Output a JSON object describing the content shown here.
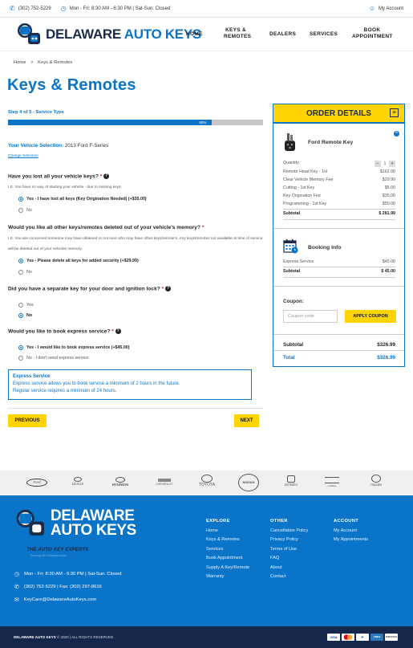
{
  "topbar": {
    "phone": "(302) 752-5229",
    "hours": "Mon - Fri: 8:30 AM - 6:30 PM | Sat-Sun: Closed",
    "account": "My Account"
  },
  "brand": {
    "word_a": "DELAWARE",
    "word_b": " AUTO KEYS"
  },
  "nav": [
    "HOME",
    "KEYS &\nREMOTES",
    "DEALERS",
    "SERVICES",
    "BOOK\nAPPOINTMENT"
  ],
  "breadcrumb": {
    "home": "Home",
    "sep": ">",
    "current": "Keys & Remotes"
  },
  "page_title": "Keys & Remotes",
  "progress": {
    "label": "Step 4 of 5 - Service Type",
    "percent": 80,
    "percent_text": "80%"
  },
  "vehicle": {
    "label": "Your Vehicle Selection:",
    "value": " 2013 Ford F-Series",
    "change": "Change Selection"
  },
  "questions": [
    {
      "text": "Have you lost all your vehicle keys?",
      "note": "I.E. You have no way of starting your vehicle - due to missing keys.",
      "options": [
        "Yes - I have lost all keys (Key Origination Needed) (+$35.00)",
        "No"
      ]
    },
    {
      "text": "Would you like all other keys/remotes deleted out of your vehicle's memory?",
      "note": "I.E. You are concerned someone may have obtained or not sure who may have other keys/remote's. Any keys/remotes not available at time of service will be deleted out of your vehicles memory.",
      "options": [
        "Yes - Please delete all keys for added security (+$29.99)",
        "No"
      ]
    },
    {
      "text": "Did you have a separate key for your door and ignition lock?",
      "options": [
        "Yes",
        "No"
      ]
    },
    {
      "text": "Would you like to book express service?",
      "options": [
        "Yes - I would like to book express service (+$45.00)",
        "No - I don't need express service"
      ]
    }
  ],
  "express_box": {
    "title": "Express Service",
    "line1": "Express service allows you to book service a minimum of 2 hours in the future.",
    "line2": "Regular service requires a minimum of 24 hours."
  },
  "buttons": {
    "previous": "PREVIOUS",
    "next": "NEXT"
  },
  "order": {
    "title": "ORDER DETAILS",
    "menu_icon": "≡",
    "product": "Ford Remote Key",
    "quantity_label": "Quantity",
    "quantity": "1",
    "lines": [
      {
        "label": "Remote Head Key - 1st",
        "value": "$162.00"
      },
      {
        "label": "Clear Vehicle Memory Fee",
        "value": "$29.99"
      },
      {
        "label": "Cutting - 1st Key",
        "value": "$5.00"
      },
      {
        "label": "Key Origination Fee",
        "value": "$35.00"
      },
      {
        "label": "Programming - 1st Key",
        "value": "$50.00"
      }
    ],
    "subtotal_label": "Subtotal",
    "subtotal": "$ 281.99",
    "booking_title": "Booking Info",
    "booking_line_label": "Express Service",
    "booking_line_value": "$45.00",
    "booking_subtotal": "$ 45.00",
    "coupon_label": "Coupon:",
    "coupon_placeholder": "Coupon code",
    "coupon_button": "APPLY COUPON",
    "summary_subtotal_label": "Subtotal",
    "summary_subtotal": "$326.99",
    "total_label": "Total",
    "total": "$326.99"
  },
  "brands": [
    "Ford",
    "LEXUS",
    "HYUNDAI",
    "CHEVROLET",
    "TOYOTA",
    "NISSAN",
    "HONDA",
    "Cadillac",
    "mazda"
  ],
  "footer": {
    "tagline": "THE AUTO KEY EXPERTS",
    "tagline_sub": "Serving the Delaware Area",
    "hours": "Mon - Fri: 8:30 AM - 6:30 PM | Sat-Sun: Closed",
    "phone": "(302) 752-5229 | Fax: (302) 297-8616",
    "email": "KeyCare@DelawareAutoKeys.com",
    "explore_title": "EXPLORE",
    "explore": [
      "Home",
      "Keys & Remotes",
      "Services",
      "Book Appointment",
      "Supply A Key/Remote",
      "Warranty"
    ],
    "other_title": "OTHER",
    "other": [
      "Cancellation Policy",
      "Privacy Policy",
      "Terms of Use",
      "FAQ",
      "About",
      "Contact"
    ],
    "account_title": "ACCOUNT",
    "account": [
      "My Account",
      "My Appointments"
    ]
  },
  "bottom": {
    "brand": "DELAWARE AUTO KEYS",
    "copyright": " © 2020 | ALL RIGHTS RESERVED.",
    "cards": [
      "VISA",
      "MC",
      "P",
      "AMEX",
      "DISCOVER"
    ]
  },
  "colors": {
    "primary": "#0a74c9",
    "accent": "#ffd400",
    "navy": "#15274a"
  }
}
